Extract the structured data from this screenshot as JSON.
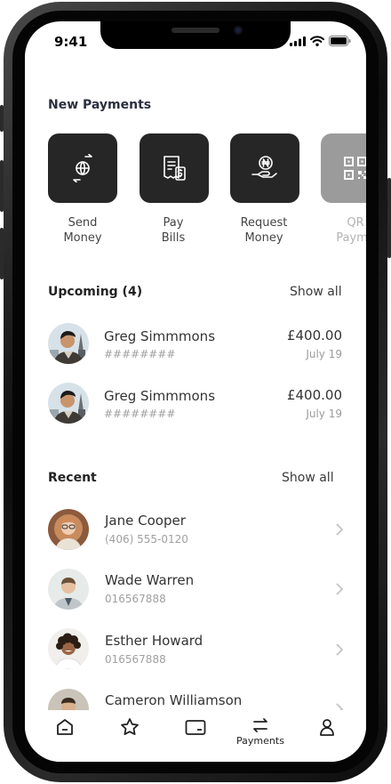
{
  "status_bar": {
    "time": "9:41"
  },
  "new_payments": {
    "title": "New Payments",
    "actions": [
      {
        "line1": "Send",
        "line2": "Money",
        "icon": "send-money-icon"
      },
      {
        "line1": "Pay",
        "line2": "Bills",
        "icon": "bill-icon"
      },
      {
        "line1": "Request",
        "line2": "Money",
        "icon": "request-money-icon"
      },
      {
        "line1": "QR",
        "line2": "Payme",
        "icon": "qr-code-icon"
      }
    ]
  },
  "upcoming": {
    "title": "Upcoming (4)",
    "show_all": "Show all",
    "items": [
      {
        "name": "Greg Simmmons",
        "account": "########",
        "amount": "£400.00",
        "date": "July 19"
      },
      {
        "name": "Greg Simmmons",
        "account": "########",
        "amount": "£400.00",
        "date": "July 19"
      }
    ]
  },
  "recent": {
    "title": "Recent",
    "show_all": "Show all",
    "items": [
      {
        "name": "Jane Cooper",
        "detail": "(406) 555-0120"
      },
      {
        "name": "Wade Warren",
        "detail": "016567888"
      },
      {
        "name": "Esther Howard",
        "detail": "016567888"
      },
      {
        "name": "Cameron Williamson",
        "detail": ""
      }
    ]
  },
  "tab_bar": {
    "items": [
      {
        "icon": "home-icon",
        "label": ""
      },
      {
        "icon": "star-icon",
        "label": ""
      },
      {
        "icon": "card-icon",
        "label": ""
      },
      {
        "icon": "transfer-icon",
        "label": "Payments"
      },
      {
        "icon": "profile-icon",
        "label": ""
      }
    ]
  }
}
